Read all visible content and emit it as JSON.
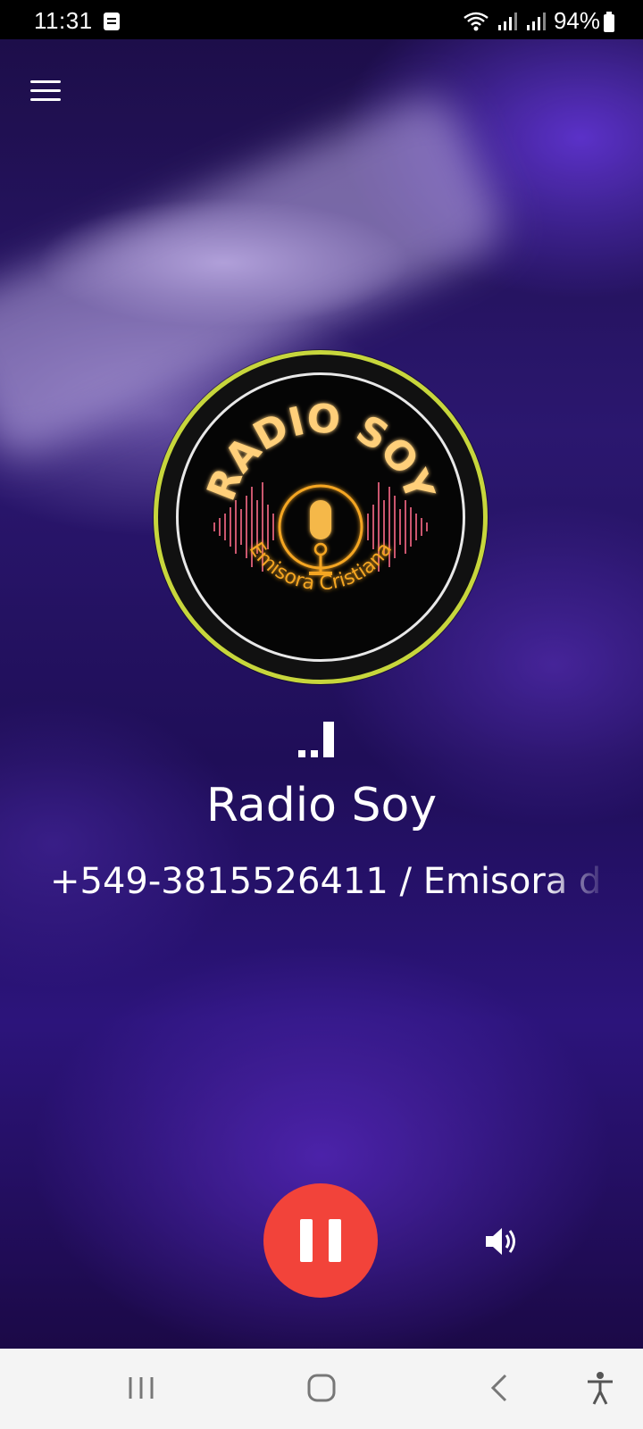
{
  "status_bar": {
    "time": "11:31",
    "battery_percent": "94%",
    "icons": [
      "notes-icon",
      "wifi-icon",
      "signal-icon",
      "signal-icon",
      "battery-icon"
    ]
  },
  "header": {
    "menu_icon": "hamburger-menu-icon"
  },
  "logo": {
    "title_text": "RADIO SOY",
    "subtitle_text": "Emisora Cristiana",
    "icon": "microphone-icon",
    "ring_color": "#c7d63c",
    "accent_color": "#f5a623",
    "wave_color": "#e0607a"
  },
  "player": {
    "station_name": "Radio Soy",
    "station_info": "+549-3815526411 / Emisora d",
    "meta_icon": "signal-bars-icon",
    "pause_icon": "pause-icon",
    "volume_icon": "volume-icon",
    "pause_button_color": "#f2433a"
  },
  "nav_bar": {
    "items": [
      "recent-apps-icon",
      "home-icon",
      "back-icon",
      "accessibility-icon"
    ]
  }
}
